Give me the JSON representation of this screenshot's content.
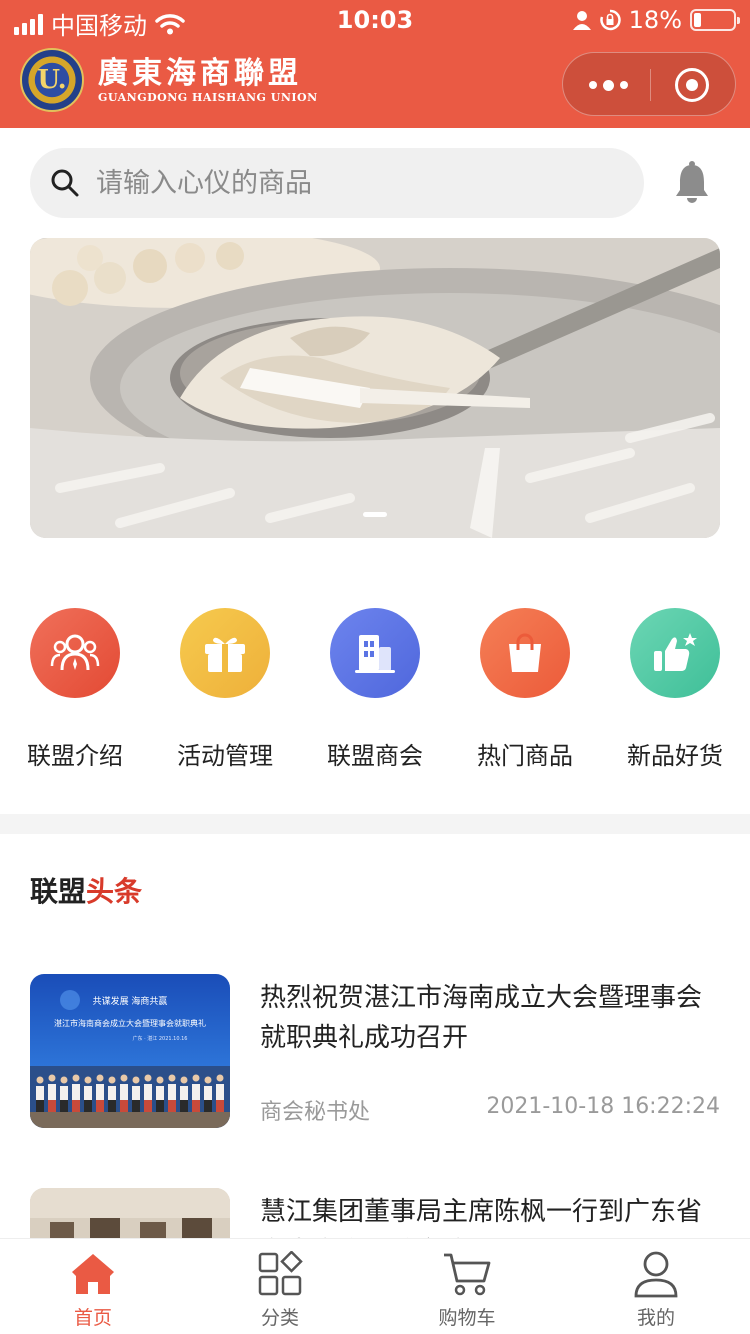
{
  "status_bar": {
    "carrier": "中国移动",
    "time": "10:03",
    "battery_percent": "18%",
    "battery_level": 0.18,
    "icons": [
      "signal-icon",
      "wifi-icon",
      "person-icon",
      "rotation-lock-icon",
      "battery-icon"
    ]
  },
  "header": {
    "logo_letter": "U.",
    "brand_cn": "廣東海商聯盟",
    "brand_en": "GUANGDONG HAISHANG UNION",
    "accent_color": "#ea5a44",
    "capsule_icons": [
      "more-dots-icon",
      "close-target-icon"
    ]
  },
  "search": {
    "placeholder": "请输入心仪的商品",
    "value": ""
  },
  "notifications": {
    "icon": "bell-icon"
  },
  "banner": {
    "slide_count": 1,
    "active_slide": 1
  },
  "categories": [
    {
      "label": "联盟介绍",
      "icon": "members-icon",
      "color": "#e9573f"
    },
    {
      "label": "活动管理",
      "icon": "gift-icon",
      "color": "#f2bb3c"
    },
    {
      "label": "联盟商会",
      "icon": "building-icon",
      "color": "#5b74e4"
    },
    {
      "label": "热门商品",
      "icon": "shopping-bag-icon",
      "color": "#f06a45"
    },
    {
      "label": "新品好货",
      "icon": "thumbs-up-star-icon",
      "color": "#4fc9a4"
    }
  ],
  "news_section": {
    "title_part1": "联盟",
    "title_part2": "头条",
    "title_part2_color": "#d83a2a"
  },
  "news": [
    {
      "title": "热烈祝贺湛江市海南成立大会暨理事会就职典礼成功召开",
      "source": "商会秘书处",
      "time": "2021-10-18 16:22:24",
      "thumb_caption_1": "共谋发展 海商共赢",
      "thumb_caption_2": "湛江市海南商会成立大会暨理事会就职典礼",
      "thumb_caption_3": "广东 · 湛江 2021.10.16"
    },
    {
      "title": "慧江集团董事局主席陈枫一行到广东省海南商会拜访交流",
      "source": "",
      "time": ""
    }
  ],
  "tabbar": [
    {
      "label": "首页",
      "icon": "home-icon",
      "active": true
    },
    {
      "label": "分类",
      "icon": "category-grid-icon",
      "active": false
    },
    {
      "label": "购物车",
      "icon": "cart-icon",
      "active": false
    },
    {
      "label": "我的",
      "icon": "profile-icon",
      "active": false
    }
  ]
}
